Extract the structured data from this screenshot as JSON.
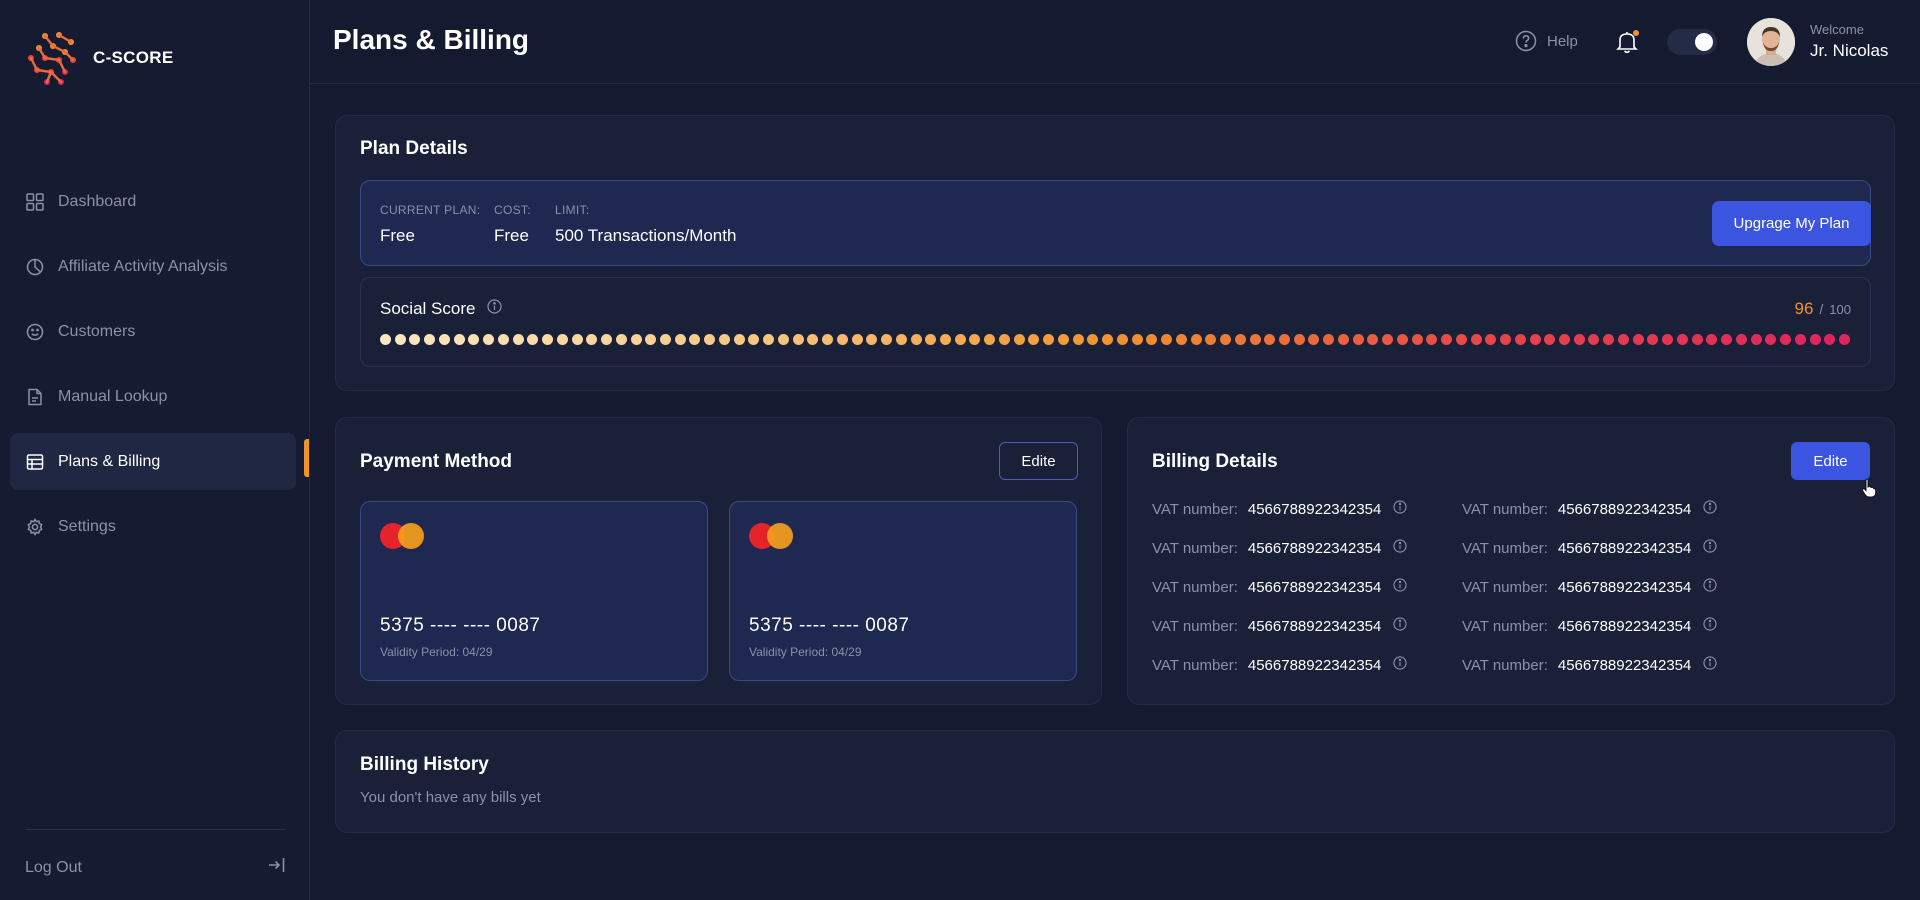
{
  "brand": {
    "name": "C-SCORE"
  },
  "sidebar": {
    "items": [
      {
        "label": "Dashboard",
        "icon": "grid-icon"
      },
      {
        "label": "Affiliate Activity Analysis",
        "icon": "pie-chart-icon"
      },
      {
        "label": "Customers",
        "icon": "smiley-icon"
      },
      {
        "label": "Manual Lookup",
        "icon": "document-icon"
      },
      {
        "label": "Plans & Billing",
        "icon": "table-icon",
        "active": true
      },
      {
        "label": "Settings",
        "icon": "gear-icon"
      }
    ],
    "logout_label": "Log Out"
  },
  "header": {
    "title": "Plans & Billing",
    "help_label": "Help",
    "welcome_label": "Welcome",
    "user_name": "Jr. Nicolas",
    "theme_toggle_on": true
  },
  "plan": {
    "title": "Plan Details",
    "current_plan_label": "CURRENT PLAN:",
    "current_plan_value": "Free",
    "cost_label": "COST:",
    "cost_value": "Free",
    "limit_label": "LIMIT:",
    "limit_value": "500 Transactions/Month",
    "upgrade_label": "Upgrage My Plan",
    "social_score_label": "Social Score",
    "social_score_value": "96",
    "social_score_sep": "/",
    "social_score_max": "100"
  },
  "payment": {
    "title": "Payment Method",
    "edit_label": "Edite",
    "cards": [
      {
        "number": "5375 ---- ---- 0087",
        "validity": "Validity Period: 04/29"
      },
      {
        "number": "5375 ---- ---- 0087",
        "validity": "Validity Period: 04/29"
      }
    ]
  },
  "billing": {
    "title": "Billing Details",
    "edit_label": "Edite",
    "vat_label": "VAT number:",
    "vat_rows": [
      [
        "4566788922342354",
        "4566788922342354"
      ],
      [
        "4566788922342354",
        "4566788922342354"
      ],
      [
        "4566788922342354",
        "4566788922342354"
      ],
      [
        "4566788922342354",
        "4566788922342354"
      ],
      [
        "4566788922342354",
        "4566788922342354"
      ]
    ]
  },
  "history": {
    "title": "Billing History",
    "empty_text": "You don't have any bills yet"
  },
  "colors": {
    "accent": "#3b55e0",
    "orange": "#f0922e",
    "score_start": "#fde7c4",
    "score_end": "#e0245e"
  }
}
